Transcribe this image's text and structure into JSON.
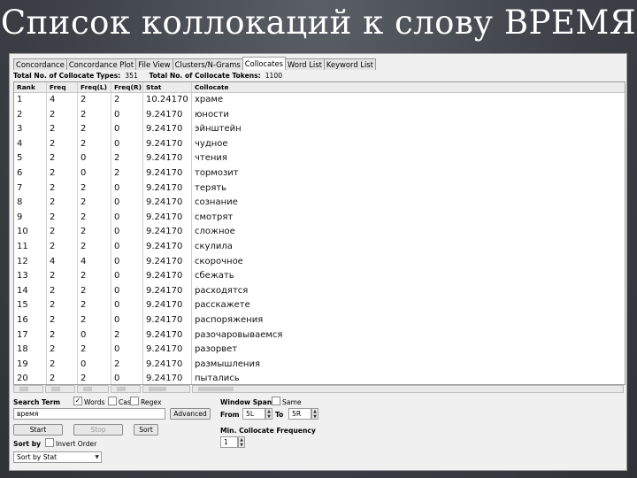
{
  "slide_title": "Список коллокаций к слову ВРЕМЯ",
  "tabs": [
    "Concordance",
    "Concordance Plot",
    "File View",
    "Clusters/N-Grams",
    "Collocates",
    "Word List",
    "Keyword List"
  ],
  "active_tab": "Collocates",
  "totals": {
    "types_label": "Total No. of Collocate Types:",
    "types_value": "351",
    "tokens_label": "Total No. of Collocate Tokens:",
    "tokens_value": "1100"
  },
  "columns": [
    "Rank",
    "Freq",
    "Freq(L)",
    "Freq(R)",
    "Stat",
    "Collocate"
  ],
  "rows": [
    [
      "1",
      "4",
      "2",
      "2",
      "10.24170",
      "храме"
    ],
    [
      "2",
      "2",
      "2",
      "0",
      "9.24170",
      "юности"
    ],
    [
      "3",
      "2",
      "2",
      "0",
      "9.24170",
      "эйнштейн"
    ],
    [
      "4",
      "2",
      "2",
      "0",
      "9.24170",
      "чудное"
    ],
    [
      "5",
      "2",
      "0",
      "2",
      "9.24170",
      "чтения"
    ],
    [
      "6",
      "2",
      "0",
      "2",
      "9.24170",
      "тормозит"
    ],
    [
      "7",
      "2",
      "2",
      "0",
      "9.24170",
      "терять"
    ],
    [
      "8",
      "2",
      "2",
      "0",
      "9.24170",
      "сознание"
    ],
    [
      "9",
      "2",
      "2",
      "0",
      "9.24170",
      "смотрят"
    ],
    [
      "10",
      "2",
      "2",
      "0",
      "9.24170",
      "сложное"
    ],
    [
      "11",
      "2",
      "2",
      "0",
      "9.24170",
      "скулила"
    ],
    [
      "12",
      "4",
      "4",
      "0",
      "9.24170",
      "скорочное"
    ],
    [
      "13",
      "2",
      "2",
      "0",
      "9.24170",
      "сбежать"
    ],
    [
      "14",
      "2",
      "2",
      "0",
      "9.24170",
      "расходятся"
    ],
    [
      "15",
      "2",
      "2",
      "0",
      "9.24170",
      "расскажете"
    ],
    [
      "16",
      "2",
      "2",
      "0",
      "9.24170",
      "распоряжения"
    ],
    [
      "17",
      "2",
      "0",
      "2",
      "9.24170",
      "разочаровываемся"
    ],
    [
      "18",
      "2",
      "2",
      "0",
      "9.24170",
      "разорвет"
    ],
    [
      "19",
      "2",
      "0",
      "2",
      "9.24170",
      "размышления"
    ],
    [
      "20",
      "2",
      "2",
      "0",
      "9.24170",
      "пытались"
    ]
  ],
  "search": {
    "label": "Search Term",
    "words_label": "Words",
    "case_label": "Case",
    "regex_label": "Regex",
    "value": "время",
    "advanced_label": "Advanced"
  },
  "buttons": {
    "start": "Start",
    "stop": "Stop",
    "sort": "Sort"
  },
  "sort": {
    "label": "Sort by",
    "invert_label": "Invert Order",
    "selected": "Sort by Stat"
  },
  "window_span": {
    "label": "Window Span",
    "same_label": "Same",
    "from_label": "From",
    "from_value": "5L",
    "to_label": "To",
    "to_value": "5R"
  },
  "min_freq": {
    "label": "Min. Collocate Frequency",
    "value": "1"
  }
}
